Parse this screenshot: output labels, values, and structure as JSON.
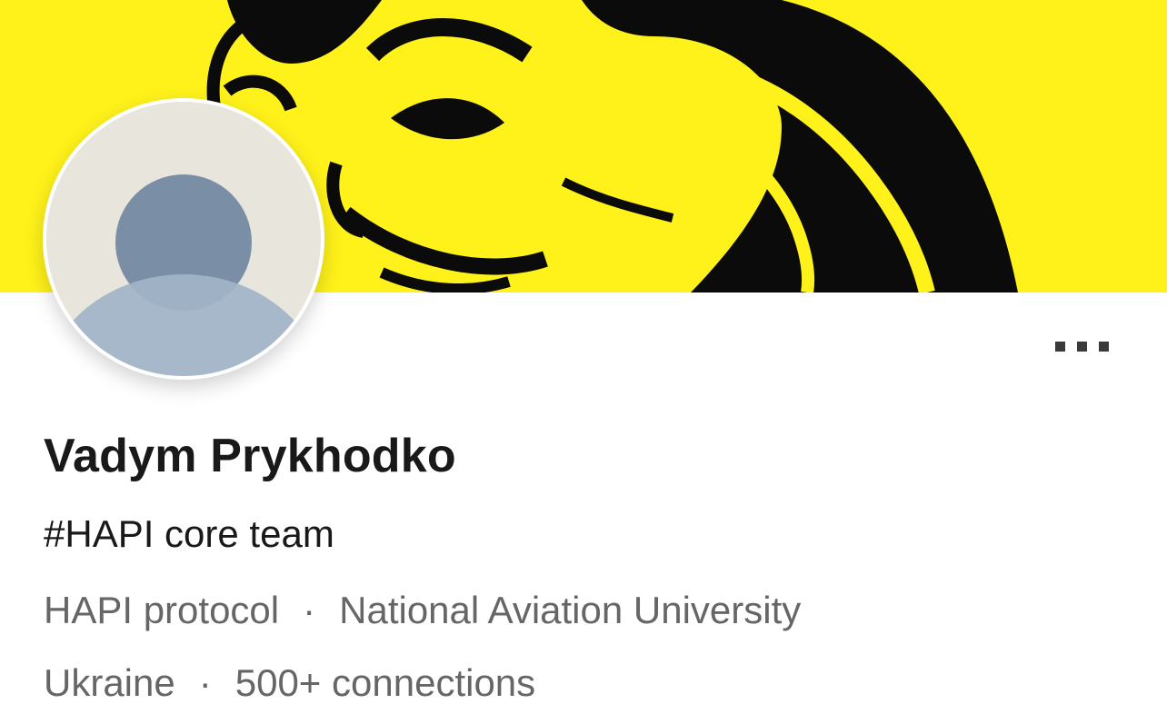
{
  "profile": {
    "name": "Vadym Prykhodko",
    "headline": "#HAPI core team",
    "company": "HAPI protocol",
    "education": "National Aviation University",
    "location": "Ukraine",
    "connections": "500+ connections",
    "separator": "·"
  },
  "banner": {
    "background_color": "#FFF21A",
    "ink_color": "#0B0B0B",
    "description_icon": "guy-fawkes-mask-illustration"
  },
  "avatar": {
    "icon": "default-person-placeholder-icon",
    "background_color": "#E8E5DD",
    "head_color": "#7A8FA6",
    "body_color": "#A1B4C8"
  },
  "actions": {
    "more_icon": "more-options-icon"
  }
}
